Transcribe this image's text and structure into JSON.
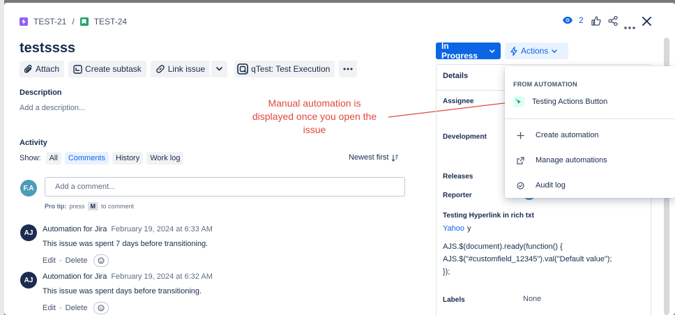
{
  "breadcrumb": {
    "parent_key": "TEST-21",
    "separator": "/",
    "issue_key": "TEST-24"
  },
  "header": {
    "watch_count": "2"
  },
  "issue": {
    "title": "testssss"
  },
  "toolbar": {
    "attach": "Attach",
    "create_subtask": "Create subtask",
    "link_issue": "Link issue",
    "qtest": "qTest: Test Execution"
  },
  "description": {
    "label": "Description",
    "placeholder": "Add a description..."
  },
  "activity": {
    "label": "Activity",
    "show_label": "Show:",
    "tabs": [
      "All",
      "Comments",
      "History",
      "Work log"
    ],
    "active_tab": "Comments",
    "sort": "Newest first",
    "current_user_initials": "F.A",
    "comment_placeholder": "Add a comment...",
    "pro_tip_prefix": "Pro tip:",
    "pro_tip_press": "press",
    "pro_tip_key": "M",
    "pro_tip_suffix": "to comment"
  },
  "comments": [
    {
      "initials": "AJ",
      "author": "Automation for Jira",
      "date": "February 19, 2024 at 6:33 AM",
      "body": "This issue was spent 7 days before transitioning.",
      "edit": "Edit",
      "sep": "·",
      "delete": "Delete"
    },
    {
      "initials": "AJ",
      "author": "Automation for Jira",
      "date": "February 19, 2024 at 6:32 AM",
      "body": "This issue was spent  days before transitioning.",
      "edit": "Edit",
      "sep": "·",
      "delete": "Delete"
    }
  ],
  "status": {
    "label": "In Progress"
  },
  "actions": {
    "label": "Actions"
  },
  "details": {
    "heading": "Details",
    "assignee": "Assignee",
    "development": "Development",
    "releases": "Releases",
    "reporter": "Reporter",
    "hyperlink_label": "Testing Hyperlink in rich txt",
    "hyperlink_link": "Yahoo",
    "hyperlink_suffix": "y",
    "code_lines": [
      "AJS.$(document).ready(function() {",
      "AJS.$(\"#customfield_12345\").val(\"Default value\");",
      "});"
    ],
    "labels_label": "Labels",
    "labels_value": "None"
  },
  "dropdown": {
    "heading": "FROM AUTOMATION",
    "rule_item": "Testing Actions Button",
    "create": "Create automation",
    "manage": "Manage automations",
    "audit": "Audit log"
  },
  "annotation": {
    "lines": [
      "Manual automation is",
      "displayed once you open the",
      "issue"
    ]
  },
  "colors": {
    "accent": "#0c66e4",
    "annotation": "#e2483d",
    "subtask_purple": "#8f5ff5",
    "story_green": "#22a06b",
    "avatar_dark": "#1d2b4f",
    "avatar_teal": "#4f9bb9"
  }
}
